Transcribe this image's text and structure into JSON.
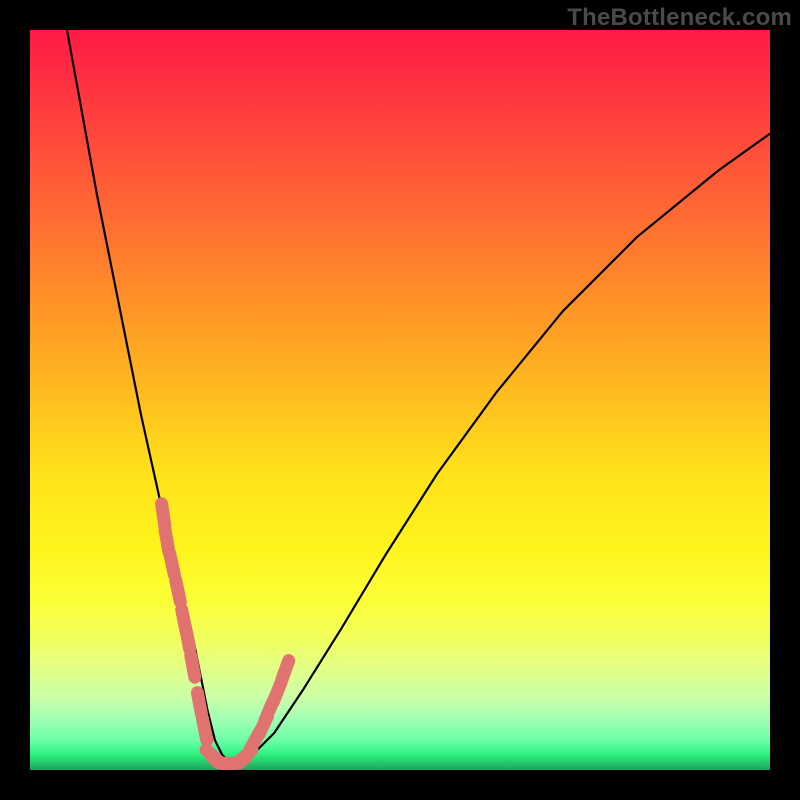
{
  "watermark": "TheBottleneck.com",
  "colors": {
    "background": "#000000",
    "curve": "#000000",
    "salmon_marker": "#e0736f",
    "salmon_marker_edge": "#d46a66"
  },
  "chart_data": {
    "type": "line",
    "title": "",
    "xlabel": "",
    "ylabel": "",
    "xlim": [
      0,
      100
    ],
    "ylim": [
      0,
      100
    ],
    "grid": false,
    "legend": false,
    "background_gradient": "red→orange→yellow→green (top to bottom)",
    "series": [
      {
        "name": "bottleneck-curve",
        "x": [
          5,
          7,
          9,
          11,
          13,
          15,
          17,
          19,
          20,
          21,
          22,
          23,
          24,
          25,
          26,
          27,
          28,
          30,
          33,
          37,
          42,
          48,
          55,
          63,
          72,
          82,
          93,
          100
        ],
        "y": [
          100,
          89,
          78,
          68,
          58,
          48,
          39,
          30,
          26,
          22,
          18,
          13,
          8,
          4,
          2,
          1,
          1,
          2,
          5,
          11,
          19,
          29,
          40,
          51,
          62,
          72,
          81,
          86
        ]
      },
      {
        "name": "salmon-markers-left",
        "x": [
          18.0,
          18.5,
          19.2,
          20.0,
          20.8,
          21.3,
          22.0,
          22.9,
          23.6
        ],
        "y": [
          34.5,
          31.0,
          27.8,
          24.2,
          20.2,
          17.8,
          14.0,
          9.0,
          5.5
        ]
      },
      {
        "name": "salmon-markers-right",
        "x": [
          30.4,
          31.5,
          32.3,
          33.4,
          34.5
        ],
        "y": [
          4.0,
          6.0,
          8.0,
          10.5,
          13.5
        ]
      },
      {
        "name": "salmon-markers-bottom",
        "x": [
          24.6,
          25.6,
          26.4,
          27.3,
          28.2,
          29.2
        ],
        "y": [
          2.0,
          1.1,
          0.9,
          0.9,
          1.1,
          2.0
        ]
      }
    ]
  }
}
